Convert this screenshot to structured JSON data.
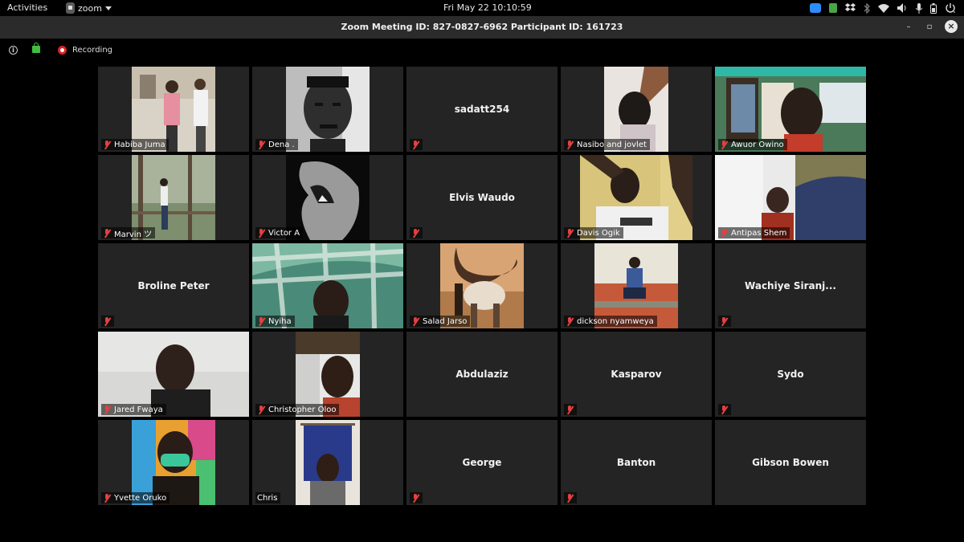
{
  "topbar": {
    "activities": "Activities",
    "app_name": "zoom",
    "clock": "Fri May 22  10:10:59",
    "tray_icons": [
      "zoom-icon",
      "green-app-icon",
      "dropbox-icon",
      "bluetooth-icon",
      "wifi-icon",
      "volume-icon",
      "microphone-icon",
      "battery-icon",
      "power-icon"
    ]
  },
  "window": {
    "title": "Zoom Meeting ID: 827-0827-6962 Participant ID: 161723",
    "minimize": "–",
    "restore": "▫",
    "close": "×"
  },
  "infobar": {
    "info_icon": "i",
    "recording_label": "Recording"
  },
  "participants": [
    {
      "name": "Habiba Juma",
      "video": true,
      "muted": true
    },
    {
      "name": "Dena .",
      "video": true,
      "muted": true
    },
    {
      "name": "sadatt254",
      "video": false,
      "muted": true
    },
    {
      "name": "Nasibo and jovlet",
      "video": true,
      "muted": true
    },
    {
      "name": "Awuor Owino",
      "video": true,
      "muted": true
    },
    {
      "name": "Marvin ツ",
      "video": true,
      "muted": true
    },
    {
      "name": "Victor A",
      "video": true,
      "muted": true
    },
    {
      "name": "Elvis Waudo",
      "video": false,
      "muted": true
    },
    {
      "name": "Davis Ogik",
      "video": true,
      "muted": true
    },
    {
      "name": "Antipas Shem",
      "video": true,
      "muted": true
    },
    {
      "name": "Broline Peter",
      "video": false,
      "muted": true
    },
    {
      "name": "Nyiha",
      "video": true,
      "muted": true
    },
    {
      "name": "Salad Jarso",
      "video": true,
      "muted": true
    },
    {
      "name": "dickson nyamweya",
      "video": true,
      "muted": true
    },
    {
      "name": "Wachiye Siranj...",
      "video": false,
      "muted": true
    },
    {
      "name": "Jared Fwaya",
      "video": true,
      "muted": true
    },
    {
      "name": "Christopher Oloo",
      "video": true,
      "muted": true
    },
    {
      "name": "Abdulaziz",
      "video": false,
      "muted": true
    },
    {
      "name": "Kasparov",
      "video": false,
      "muted": true
    },
    {
      "name": "Sydo",
      "video": false,
      "muted": true
    },
    {
      "name": "Yvette Oruko",
      "video": true,
      "muted": true
    },
    {
      "name": "Chris",
      "video": true,
      "muted": false
    },
    {
      "name": "George",
      "video": false,
      "muted": true
    },
    {
      "name": "Banton",
      "video": false,
      "muted": true
    },
    {
      "name": "Gibson Bowen",
      "video": false,
      "muted": true
    }
  ]
}
